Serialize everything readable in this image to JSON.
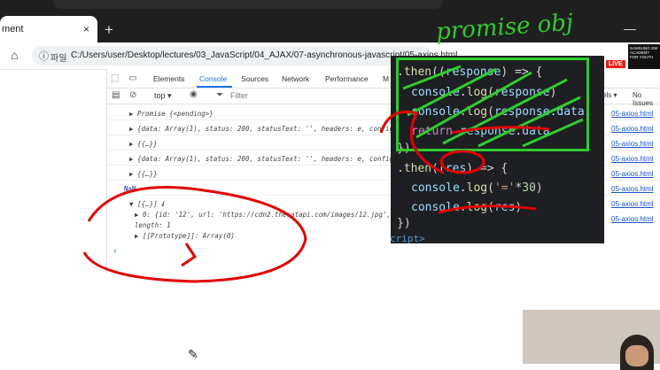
{
  "browser": {
    "tab_title": "ment",
    "tab_close": "×",
    "new_tab": "+",
    "window_min": "—",
    "home_icon": "⌂",
    "info_icon": "ⓘ",
    "file_label": "파일",
    "url": "C:/Users/user/Desktop/lectures/03_JavaScript/04_AJAX/07-asynchronous-javascript/05-axios.html",
    "live_badge": "LIVE",
    "channel_logo": "SAMSUNG SW ACADEMY FOR YOUTH"
  },
  "page": {
    "left_text": "NaN",
    "bottom_icon": "✎"
  },
  "devtools": {
    "tabs": [
      "Elements",
      "Console",
      "Sources",
      "Network",
      "Performance",
      "M"
    ],
    "context": "top ▾",
    "filter_placeholder": "Filter",
    "levels": "els ▾",
    "issues": "No Issues",
    "logs": [
      "▶ Promise {<pending>}",
      "▶ {data: Array(1), status: 200, statusText: '', headers: e, config",
      "▶ {{…}}",
      "▶ {data: Array(1), status: 200, statusText: '', headers: e, config",
      "▶ {{…}}",
      "NaN",
      "▼ [{…}] ℹ",
      "▶ 0: {id: '12', url: 'https://cdn2.thecatapi.com/images/12.jpg',",
      "   length: 1",
      "▶ [[Prototype]]: Array(0)"
    ],
    "links": [
      "05-axios.html",
      "05-axios.html",
      "05-axios.html",
      "05-axios.html",
      "05-axios.html",
      "05-axios.html",
      "05-axios.html",
      "05-axios.html"
    ],
    "prompt": "›"
  },
  "code": {
    "line1": [
      ".then",
      "((",
      "response",
      ") => {"
    ],
    "line2": [
      "console",
      ".",
      "log",
      "(",
      "response",
      ")"
    ],
    "line3": [
      "console",
      ".",
      "log",
      "(",
      "response",
      ".",
      "data",
      ")"
    ],
    "line4": [
      "return ",
      "response",
      ".",
      "data"
    ],
    "line5": [
      "})"
    ],
    "line6": [
      ".then",
      "((",
      "res",
      ") => {"
    ],
    "line7": [
      "console",
      ".",
      "log",
      "(",
      "'='",
      "*",
      "30",
      ")"
    ],
    "line8": [
      "console",
      ".",
      "log",
      "(",
      "res",
      ")"
    ],
    "line9": [
      "})"
    ],
    "line10": [
      "cript>"
    ]
  },
  "annotation": "promise obj"
}
